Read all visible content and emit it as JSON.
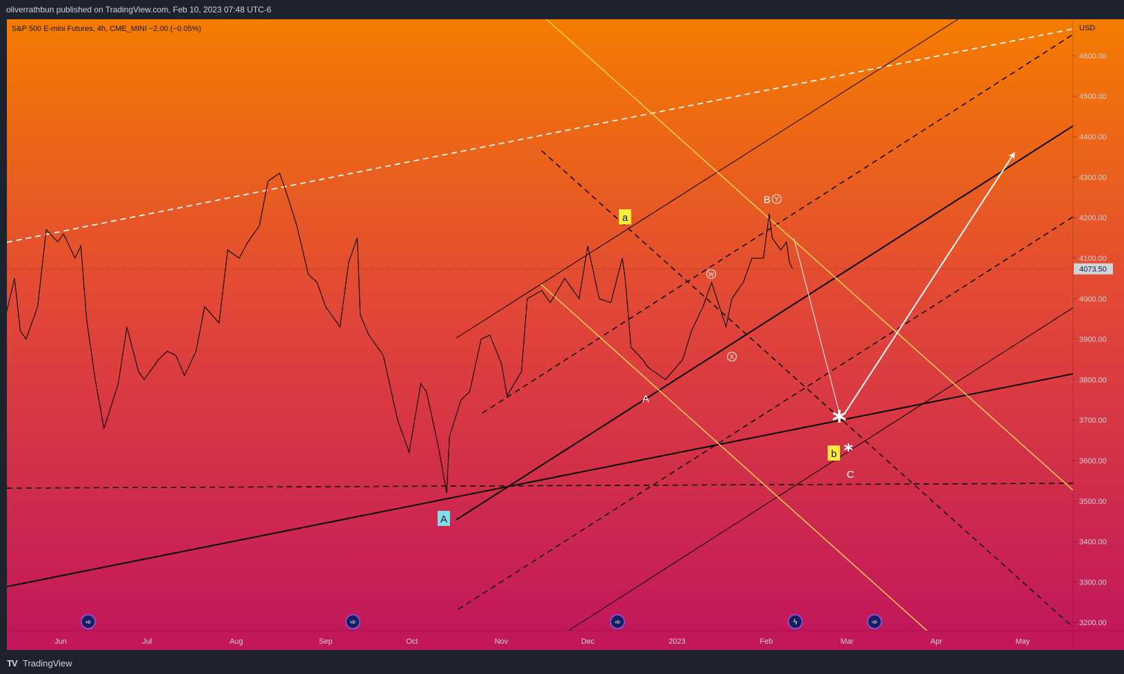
{
  "header": {
    "publisher": "oliverrathbun published on TradingView.com, Feb 10, 2023 07:48 UTC-6"
  },
  "footer": {
    "logo": "TV",
    "brand": "TradingView"
  },
  "colors": {
    "gradient_top": "#f57c00",
    "gradient_mid": "#e0443a",
    "gradient_bottom": "#c2185b",
    "price_line": "#000000",
    "yellow_line": "#ffd54f",
    "white_line": "#ffffff",
    "label_yellow": "#ffeb3b",
    "label_cyan": "#80deea"
  },
  "chart_data": {
    "type": "line",
    "legend": "S&P 500 E-mini Futures, 4h, CME_MINI  −2.00 (−0.05%)",
    "currency": "USD",
    "last_price": "4073.50",
    "ylim": [
      3180,
      4690
    ],
    "y_ticks": [
      "4600.00",
      "4500.00",
      "4400.00",
      "4300.00",
      "4200.00",
      "4100.00",
      "4000.00",
      "3900.00",
      "3800.00",
      "3700.00",
      "3600.00",
      "3500.00",
      "3400.00",
      "3300.00",
      "3200.00"
    ],
    "x_ticks": [
      "Jun",
      "Jul",
      "Aug",
      "Sep",
      "Oct",
      "Nov",
      "Dec",
      "2023",
      "Feb",
      "Mar",
      "Apr",
      "May"
    ],
    "x_tick_dates": [
      "2022-06-01",
      "2022-07-01",
      "2022-08-01",
      "2022-09-01",
      "2022-10-01",
      "2022-11-01",
      "2022-12-01",
      "2023-01-01",
      "2023-02-01",
      "2023-03-01",
      "2023-04-01",
      "2023-05-01"
    ],
    "series": [
      {
        "x": [
          "2022-05-01",
          "2022-05-03",
          "2022-05-06",
          "2022-05-09",
          "2022-05-12",
          "2022-05-16",
          "2022-05-18",
          "2022-05-20",
          "2022-05-24",
          "2022-05-27",
          "2022-05-31",
          "2022-06-02",
          "2022-06-06",
          "2022-06-08",
          "2022-06-10",
          "2022-06-13",
          "2022-06-16",
          "2022-06-17",
          "2022-06-21",
          "2022-06-24",
          "2022-06-28",
          "2022-06-30",
          "2022-07-05",
          "2022-07-08",
          "2022-07-11",
          "2022-07-14",
          "2022-07-18",
          "2022-07-21",
          "2022-07-26",
          "2022-07-29",
          "2022-08-02",
          "2022-08-05",
          "2022-08-09",
          "2022-08-12",
          "2022-08-16",
          "2022-08-18",
          "2022-08-22",
          "2022-08-26",
          "2022-08-29",
          "2022-09-01",
          "2022-09-06",
          "2022-09-09",
          "2022-09-12",
          "2022-09-13",
          "2022-09-16",
          "2022-09-21",
          "2022-09-26",
          "2022-09-30",
          "2022-10-04",
          "2022-10-06",
          "2022-10-10",
          "2022-10-13",
          "2022-10-14",
          "2022-10-18",
          "2022-10-21",
          "2022-10-25",
          "2022-10-28",
          "2022-11-01",
          "2022-11-03",
          "2022-11-08",
          "2022-11-10",
          "2022-11-15",
          "2022-11-18",
          "2022-11-23",
          "2022-11-28",
          "2022-12-01",
          "2022-12-05",
          "2022-12-09",
          "2022-12-13",
          "2022-12-14",
          "2022-12-16",
          "2022-12-20",
          "2022-12-22",
          "2022-12-28",
          "2023-01-03",
          "2023-01-06",
          "2023-01-10",
          "2023-01-13",
          "2023-01-18",
          "2023-01-20",
          "2023-01-24",
          "2023-01-27",
          "2023-01-31",
          "2023-02-02",
          "2023-02-03",
          "2023-02-06",
          "2023-02-08",
          "2023-02-09",
          "2023-02-10"
        ],
        "values": [
          4080,
          4160,
          4010,
          3990,
          3930,
          4050,
          3920,
          3900,
          3980,
          4170,
          4140,
          4160,
          4100,
          4130,
          3950,
          3800,
          3680,
          3700,
          3790,
          3930,
          3820,
          3800,
          3850,
          3870,
          3860,
          3810,
          3870,
          3980,
          3940,
          4120,
          4100,
          4140,
          4180,
          4290,
          4310,
          4270,
          4180,
          4060,
          4040,
          3980,
          3930,
          4090,
          4150,
          3960,
          3910,
          3860,
          3700,
          3620,
          3790,
          3770,
          3640,
          3520,
          3660,
          3750,
          3770,
          3900,
          3910,
          3840,
          3760,
          3820,
          4000,
          4020,
          3990,
          4050,
          4000,
          4130,
          4000,
          3990,
          4100,
          4050,
          3880,
          3850,
          3830,
          3800,
          3850,
          3920,
          3980,
          4040,
          3930,
          4000,
          4040,
          4100,
          4100,
          4210,
          4150,
          4120,
          4140,
          4090,
          4075
        ]
      }
    ],
    "annotations": {
      "a": "a",
      "A_box": "A",
      "A_small": "A",
      "B": "B",
      "Y": "Y",
      "W": "W",
      "X": "X",
      "b": "b",
      "C": "C",
      "star1": "*",
      "star2": "*"
    },
    "grid": false,
    "legend_placement": "top-left"
  }
}
